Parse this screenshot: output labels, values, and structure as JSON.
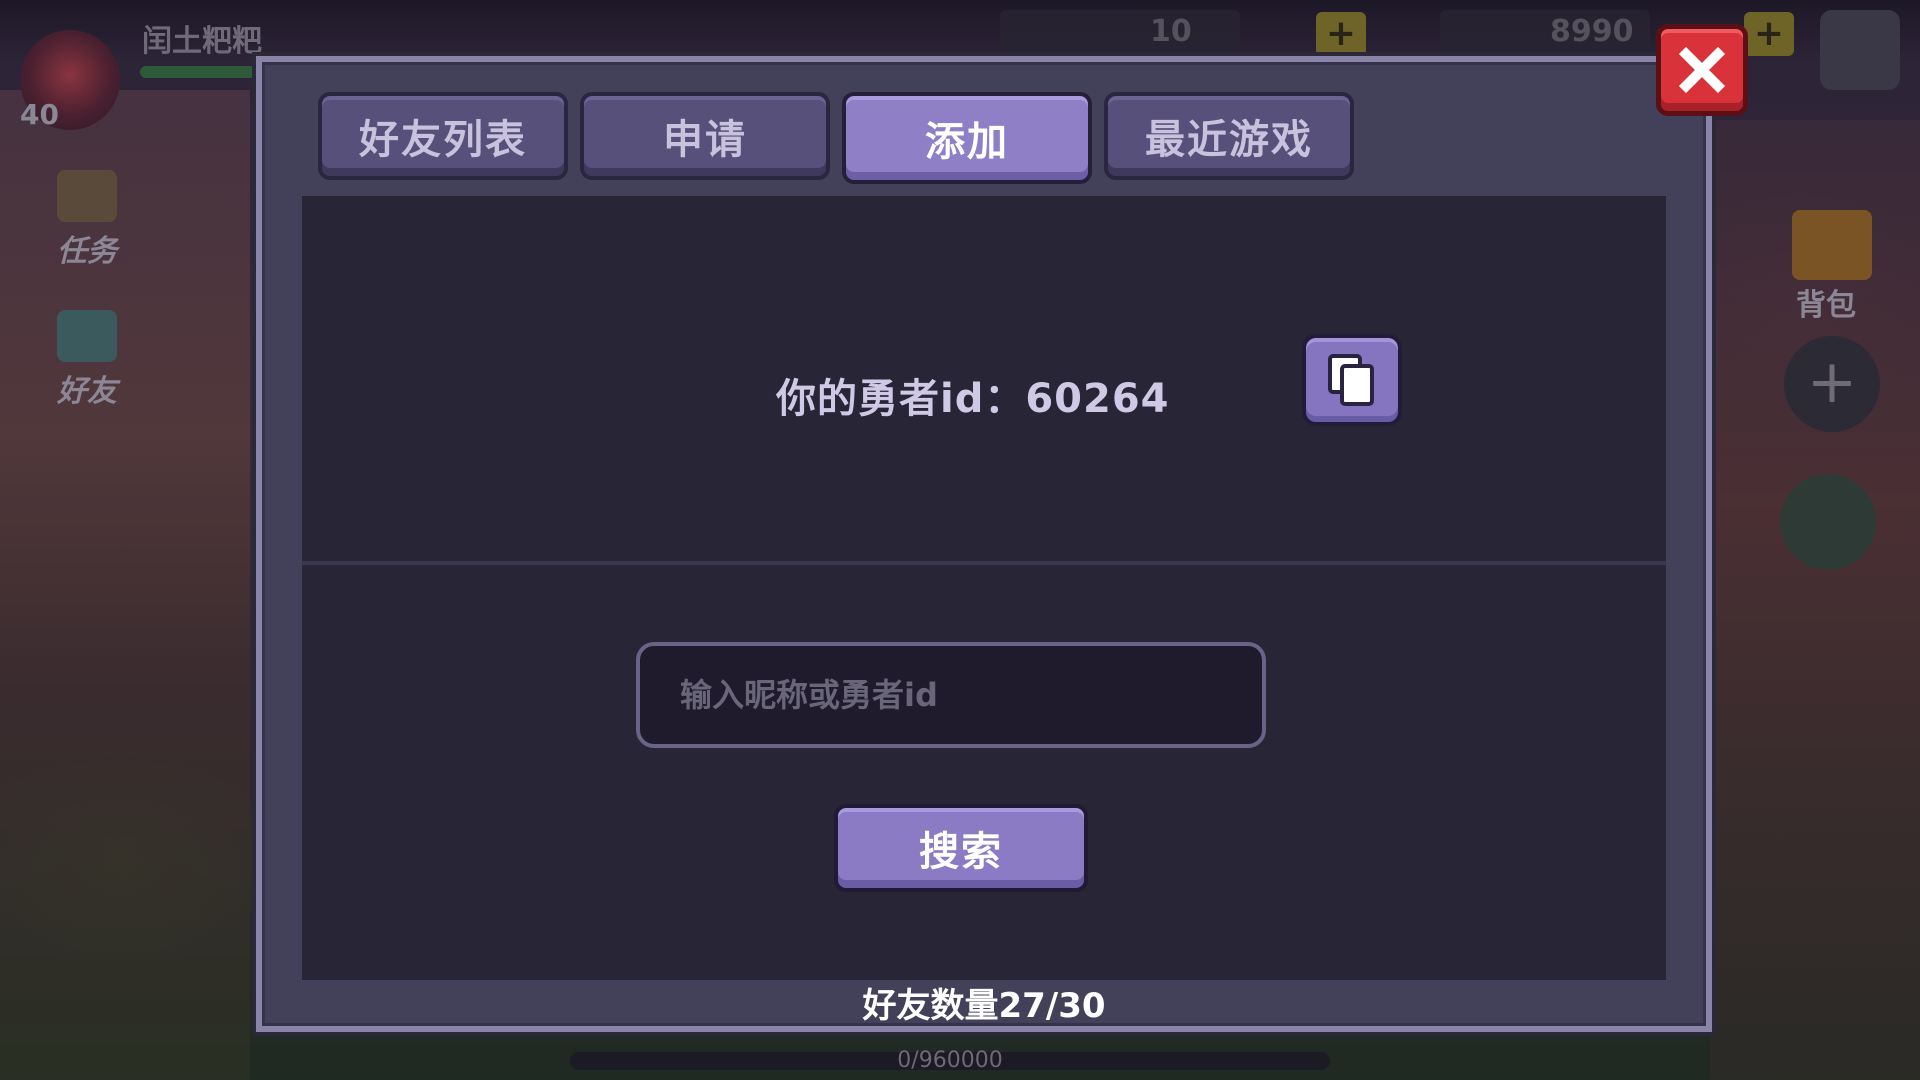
{
  "background": {
    "player_name": "闰土粑粑",
    "player_level": "40",
    "side_buttons": [
      "任务",
      "好友"
    ],
    "bag_label": "背包",
    "gold_text": "8990",
    "gem_text": "10",
    "exp_text": "0/960000"
  },
  "dialog": {
    "tabs": [
      {
        "label": "好友列表",
        "active": false
      },
      {
        "label": "申请",
        "active": false
      },
      {
        "label": "添加",
        "active": true
      },
      {
        "label": "最近游戏",
        "active": false
      }
    ],
    "hero_id_label": "你的勇者id：60264",
    "search_placeholder": "输入昵称或勇者id",
    "search_value": "",
    "search_button": "搜索",
    "friend_count": "好友数量27/30"
  },
  "colors": {
    "accent": "#8e7fc6",
    "close": "#d9323a",
    "panel": "#282536"
  },
  "icons": {
    "copy": "copy-icon",
    "close": "close-icon"
  }
}
